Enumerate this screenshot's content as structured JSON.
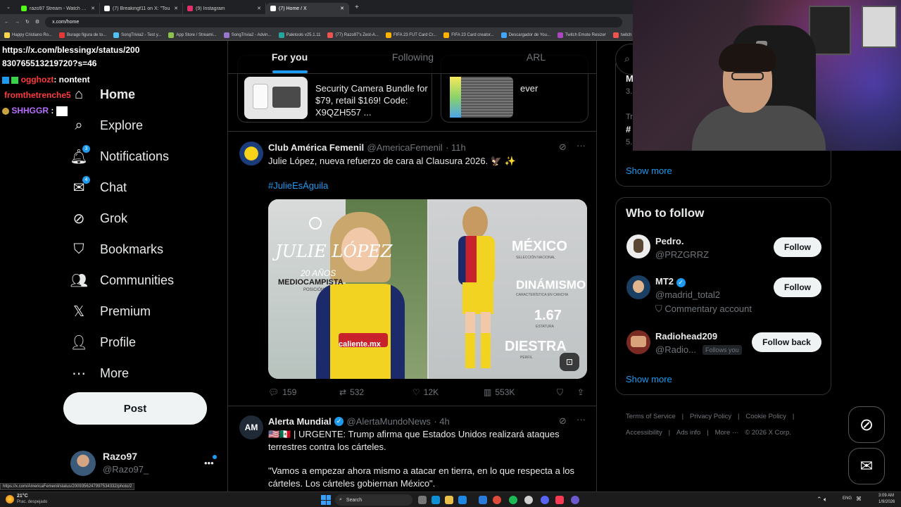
{
  "browser": {
    "tabs": [
      {
        "label": "razo97 Stream - Watch Live on",
        "color": "#53fc18"
      },
      {
        "label": "(7) Breakingf11 on X: \"Tou",
        "color": "#ffffff"
      },
      {
        "label": "(9) Instagram",
        "color": "#e1306c"
      },
      {
        "label": "(7) Home / X",
        "color": "#ffffff"
      }
    ],
    "new_tab": "+",
    "url": "x.com/home",
    "bookmarks": [
      "Happy Cristiano Ro...",
      "Burago figura de to...",
      "SongTrivia2 - Test y...",
      "App Store / Streami...",
      "SongTrivia2 - Advin...",
      "Paletools v25.1.11",
      "(77) Razo97's Zest-A...",
      "FIFA 23 FUT Card Cr...",
      "FIFA 23 Card creator...",
      "Descargador de You...",
      "Twitch Emote Resizer",
      "twitch em"
    ]
  },
  "overlay": {
    "url_line1": "https://x.com/blessingx/status/200",
    "url_line2": "830765513219720?s=46",
    "chat": [
      {
        "user": "ogghozt",
        "msg": ": nontent",
        "color": "#ff3a3a"
      },
      {
        "user": "fromthetrenche5",
        "msg": "",
        "color": "#ff3a3a"
      },
      {
        "user": "SHHGGR",
        "msg": ":",
        "color": "#b86cff"
      }
    ]
  },
  "sidebar": {
    "items": [
      {
        "label": "Home",
        "icon": "home-icon",
        "badge": ""
      },
      {
        "label": "Explore",
        "icon": "search-icon",
        "badge": ""
      },
      {
        "label": "Notifications",
        "icon": "bell-icon",
        "badge": "3"
      },
      {
        "label": "Chat",
        "icon": "mail-icon",
        "badge": "4"
      },
      {
        "label": "Grok",
        "icon": "grok-icon",
        "badge": ""
      },
      {
        "label": "Bookmarks",
        "icon": "bookmark-icon",
        "badge": ""
      },
      {
        "label": "Communities",
        "icon": "communities-icon",
        "badge": ""
      },
      {
        "label": "Premium",
        "icon": "x-logo-icon",
        "badge": ""
      },
      {
        "label": "Profile",
        "icon": "person-icon",
        "badge": ""
      },
      {
        "label": "More",
        "icon": "more-circle-icon",
        "badge": ""
      }
    ],
    "post_label": "Post",
    "account": {
      "name": "Razo97",
      "handle": "@Razo97_",
      "more": "•••"
    },
    "status_url": "https://x.com/AmericaFemenil/status/2009356247997534332/photo/2"
  },
  "feed": {
    "tabs": [
      "For you",
      "Following",
      "ARL"
    ],
    "promo_text": "Security Camera Bundle for $79, retail $169! Code: X9QZH557 ...",
    "promo2_text": "ever",
    "tweets": [
      {
        "name": "Club América Femenil",
        "handle": "@AmericaFemenil",
        "time": "· 11h",
        "text": "Julie López, nueva refuerzo de cara al Clausura 2026. 🦅 ✨",
        "hashtag": "#JulieEsÁguila",
        "image_left": {
          "name": "JULIE LÓPEZ",
          "age": "20 AÑOS",
          "position": "MEDIOCAMPISTA",
          "position_sub": "POSICIÓN",
          "sponsor": "caliente.mx"
        },
        "image_right": {
          "country": "MÉXICO",
          "country_sub": "SELECCIÓN NACIONAL",
          "trait": "DINÁMISMO",
          "trait_sub": "CARACTERÍSTICA EN CANCHA",
          "height": "1.67",
          "height_sub": "ESTATURA",
          "foot": "DIESTRA",
          "foot_sub": "PERFIL"
        },
        "replies": "159",
        "reposts": "532",
        "likes": "12K",
        "views": "553K"
      },
      {
        "name": "Alerta Mundial",
        "handle": "@AlertaMundoNews",
        "time": "· 4h",
        "text": "🇺🇸🇲🇽 | URGENTE: Trump afirma que Estados Unidos realizará ataques terrestres contra los cárteles.",
        "text2": "\"Vamos a empezar ahora mismo a atacar en tierra, en lo que respecta a los cárteles. Los cárteles gobiernan México\"."
      }
    ]
  },
  "right": {
    "trend_m": "M",
    "trend_3": "3.",
    "trend_tr": "Tr",
    "trend_hash": "#",
    "trend_5": "5.",
    "show_more": "Show more",
    "who_title": "Who to follow",
    "follow": [
      {
        "name": "Pedro.",
        "handle": "@PRZGRRZ",
        "button": "Follow",
        "extra": "",
        "verified": false
      },
      {
        "name": "MT2",
        "handle": "@madrid_total2",
        "button": "Follow",
        "extra": "Commentary account",
        "verified": true
      },
      {
        "name": "Radiohead209",
        "handle": "@Radio...",
        "button": "Follow back",
        "extra": "Follows you",
        "verified": false
      }
    ],
    "show_more2": "Show more",
    "footer": [
      "Terms of Service",
      "|",
      "Privacy Policy",
      "|",
      "Cookie Policy",
      "|",
      "Accessibility",
      "|",
      "Ads info",
      "|",
      "More ···",
      "© 2026 X Corp."
    ]
  },
  "taskbar": {
    "weather": "21°C",
    "weather_sub": "Prac. despejado",
    "search": "Search",
    "lang": "ENG",
    "time": "3:09 AM",
    "date": "1/9/2026"
  }
}
